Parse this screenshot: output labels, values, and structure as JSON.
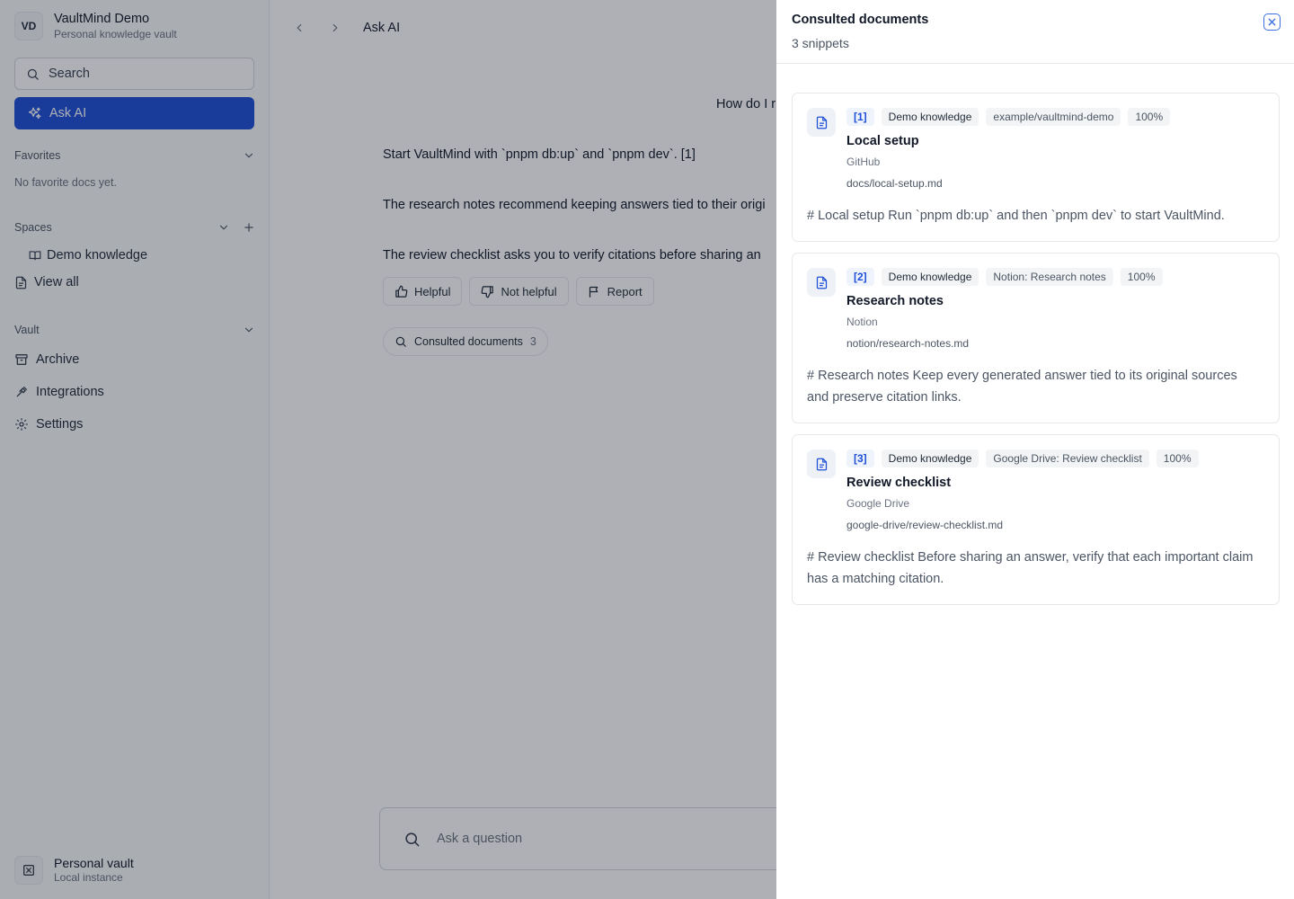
{
  "workspace": {
    "initials": "VD",
    "name": "VaultMind Demo",
    "subtitle": "Personal knowledge vault"
  },
  "sidebar": {
    "search_label": "Search",
    "ask_label": "Ask AI",
    "favorites": {
      "title": "Favorites",
      "empty": "No favorite docs yet."
    },
    "spaces": {
      "title": "Spaces",
      "items": [
        "Demo knowledge"
      ],
      "view_all": "View all"
    },
    "vault": {
      "title": "Vault",
      "items": [
        "Archive",
        "Integrations",
        "Settings"
      ]
    },
    "footer": {
      "name": "Personal vault",
      "subtitle": "Local instance"
    }
  },
  "main": {
    "breadcrumb": "Ask AI",
    "question": "How do I r",
    "answer_lines": [
      "Start VaultMind with `pnpm db:up` and `pnpm dev`. [1]",
      "The research notes recommend keeping answers tied to their origi",
      "The review checklist asks you to verify citations before sharing an"
    ],
    "feedback": {
      "helpful": "Helpful",
      "not_helpful": "Not helpful",
      "report": "Report"
    },
    "consulted": {
      "label": "Consulted documents",
      "count": "3"
    },
    "composer_placeholder": "Ask a question"
  },
  "drawer": {
    "title": "Consulted documents",
    "subtitle": "3 snippets",
    "cards": [
      {
        "citation": "[1]",
        "space": "Demo knowledge",
        "origin": "example/vaultmind-demo",
        "score": "100%",
        "title": "Local setup",
        "source": "GitHub",
        "path": "docs/local-setup.md",
        "snippet": "# Local setup Run `pnpm db:up` and then `pnpm dev` to start VaultMind."
      },
      {
        "citation": "[2]",
        "space": "Demo knowledge",
        "origin": "Notion: Research notes",
        "score": "100%",
        "title": "Research notes",
        "source": "Notion",
        "path": "notion/research-notes.md",
        "snippet": "# Research notes Keep every generated answer tied to its original sources and preserve citation links."
      },
      {
        "citation": "[3]",
        "space": "Demo knowledge",
        "origin": "Google Drive: Review checklist",
        "score": "100%",
        "title": "Review checklist",
        "source": "Google Drive",
        "path": "google-drive/review-checklist.md",
        "snippet": "# Review checklist Before sharing an answer, verify that each important claim has a matching citation."
      }
    ]
  },
  "colors": {
    "accent": "#1d4fd8",
    "overlay": "rgba(17,24,39,0.34)",
    "border": "#e5e7eb"
  },
  "icons": [
    "search-icon",
    "sparkles-icon",
    "chevron-down-icon",
    "plus-icon",
    "book-icon",
    "document-icon",
    "archive-icon",
    "plug-icon",
    "gear-icon",
    "chevron-left-icon",
    "chevron-right-icon",
    "thumbs-up-icon",
    "thumbs-down-icon",
    "flag-icon",
    "close-icon",
    "vault-icon"
  ]
}
